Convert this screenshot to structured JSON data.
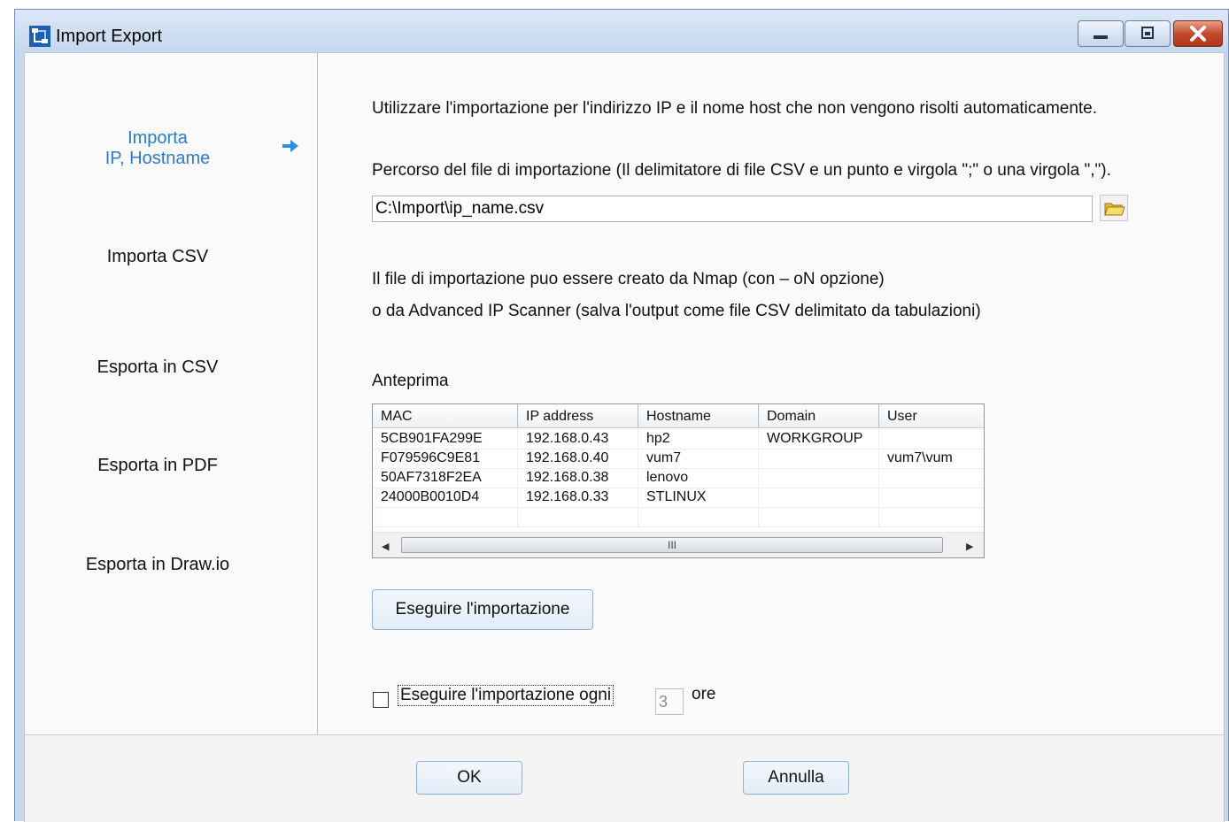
{
  "window": {
    "title": "Import Export",
    "icon": "app-network-icon"
  },
  "sidebar": {
    "items": [
      {
        "line1": "Importa",
        "line2": "IP, Hostname",
        "active": true
      },
      {
        "label": "Importa CSV"
      },
      {
        "label": "Esporta in CSV"
      },
      {
        "label": "Esporta in PDF"
      },
      {
        "label": "Esporta in Draw.io"
      }
    ],
    "active_arrow_icon": "arrow-right-icon",
    "active_color": "#2a7bd6"
  },
  "main": {
    "intro": "Utilizzare l'importazione per l'indirizzo IP e il nome host che non vengono risolti automaticamente.",
    "path_label": "Percorso del file di importazione (Il delimitatore di file CSV e un punto e virgola \";\" o una virgola \",\").",
    "path_value": "C:\\Import\\ip_name.csv",
    "browse_icon": "folder-icon",
    "info_line1": "Il file di importazione puo essere creato da Nmap (con – oN opzione)",
    "info_line2": " o da Advanced IP Scanner (salva l'output come file CSV delimitato da tabulazioni)",
    "preview_label": "Anteprima",
    "preview": {
      "columns": [
        "MAC",
        "IP address",
        "Hostname",
        "Domain",
        "User"
      ],
      "rows": [
        [
          "5CB901FA299E",
          "192.168.0.43",
          "hp2",
          "WORKGROUP",
          ""
        ],
        [
          "F079596C9E81",
          "192.168.0.40",
          "vum7",
          "",
          "vum7\\vum"
        ],
        [
          "50AF7318F2EA",
          "192.168.0.38",
          "lenovo",
          "",
          ""
        ],
        [
          "24000B0010D4",
          "192.168.0.33",
          "STLINUX",
          "",
          ""
        ]
      ],
      "scroll_thumb_grip": "III"
    },
    "run_import_label": "Eseguire l'importazione",
    "schedule": {
      "checked": false,
      "label": "Eseguire l'importazione ogni",
      "hours_value": "3",
      "unit": "ore"
    }
  },
  "footer": {
    "ok_label": "OK",
    "cancel_label": "Annulla"
  }
}
